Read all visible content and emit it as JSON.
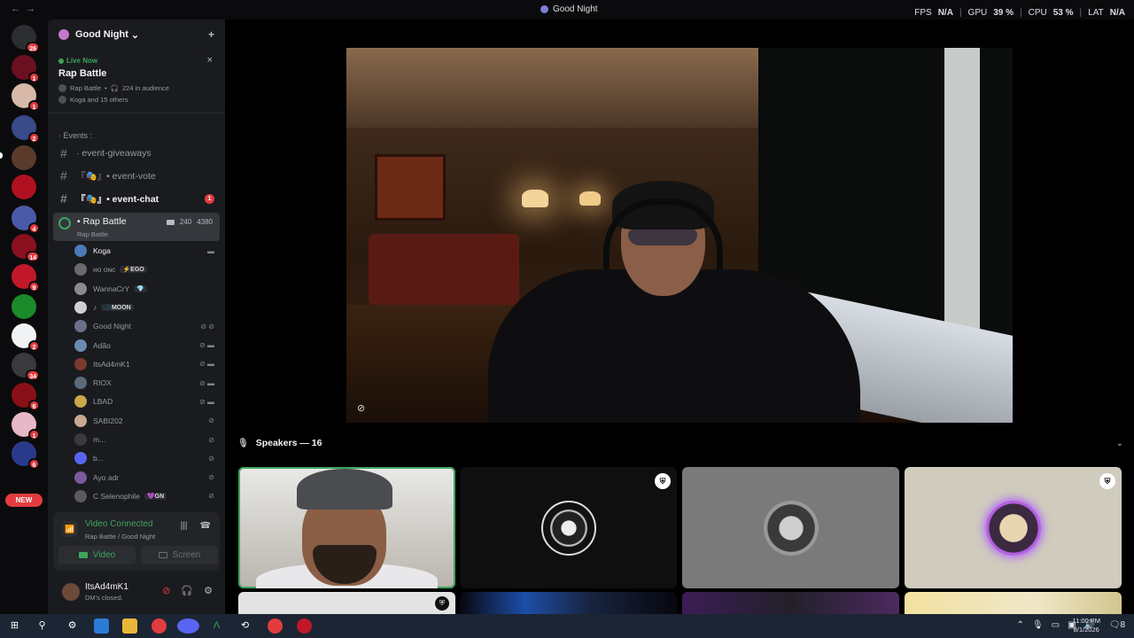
{
  "titlebar": {
    "back": "←",
    "forward": "→",
    "title": "Good Night",
    "stats": [
      {
        "label": "FPS",
        "value": "N/A"
      },
      {
        "label": "GPU",
        "value": "39 %"
      },
      {
        "label": "CPU",
        "value": "53 %"
      },
      {
        "label": "LAT",
        "value": "N/A"
      }
    ]
  },
  "rail": {
    "badges": [
      "26",
      "1",
      "1",
      "2",
      "4",
      "14",
      "9",
      "2",
      "34",
      "6",
      "1",
      "6"
    ],
    "new_label": "NEW"
  },
  "guild": {
    "name": "Good Night",
    "chevron": "⌄",
    "add_member": "+"
  },
  "live": {
    "status": "Live Now",
    "title": "Rap Battle",
    "stage": "Rap Battle",
    "audience": "224 in audience",
    "attendees": "Koga and 15 others",
    "close": "×"
  },
  "category": "· Events :",
  "channels": [
    {
      "name": "· event-giveaways",
      "bold": false
    },
    {
      "name": "『🎭』• event-vote",
      "bold": false
    },
    {
      "name": "『🎭』• event-chat",
      "bold": true,
      "count": "1"
    }
  ],
  "voice_channel": {
    "name": "• Rap Battle",
    "topic": "Rap Battle",
    "viewers": "240",
    "limit": "4380"
  },
  "members": [
    {
      "name": "Koga",
      "tag": "",
      "icons": "▬"
    },
    {
      "name": "ʜᴏ ᴏɴᴄ",
      "tag": "⚡EGO",
      "icons": ""
    },
    {
      "name": "WannaCrY",
      "tag": "💎",
      "icons": ""
    },
    {
      "name": "♪",
      "tag": "🌑MOON",
      "icons": ""
    },
    {
      "name": "Good Night",
      "tag": "",
      "icons": "⊘ ⊘"
    },
    {
      "name": "Adão",
      "tag": "",
      "icons": "⊘ ▬"
    },
    {
      "name": "ItsAd4mK1",
      "tag": "",
      "icons": "⊘ ▬"
    },
    {
      "name": "RIOX",
      "tag": "",
      "icons": "⊘ ▬"
    },
    {
      "name": "LBAD",
      "tag": "",
      "icons": "⊘ ▬"
    },
    {
      "name": "SABI202",
      "tag": "",
      "icons": "⊘"
    },
    {
      "name": "m...",
      "tag": "",
      "icons": "⊘"
    },
    {
      "name": "b...",
      "tag": "",
      "icons": "⊘"
    },
    {
      "name": "Ayo adr",
      "tag": "",
      "icons": "⊘"
    },
    {
      "name": "C Selenophile",
      "tag": "💜GN",
      "icons": "⊘"
    }
  ],
  "voice_panel": {
    "status": "Video Connected",
    "location": "Rap Battle / Good Night",
    "video_label": "Video",
    "screen_label": "Screen"
  },
  "user": {
    "name": "ItsAd4mK1",
    "status": "DM's closed."
  },
  "speakers": {
    "label": "Speakers — 16"
  },
  "taskbar": {
    "time": "11:00 PM",
    "date": "8/1/2026",
    "notifications": "8"
  },
  "colors": {
    "accent_green": "#3ba55c",
    "danger_red": "#e33c3f",
    "background": "#111214",
    "sidebar": "#1a1b1e"
  }
}
